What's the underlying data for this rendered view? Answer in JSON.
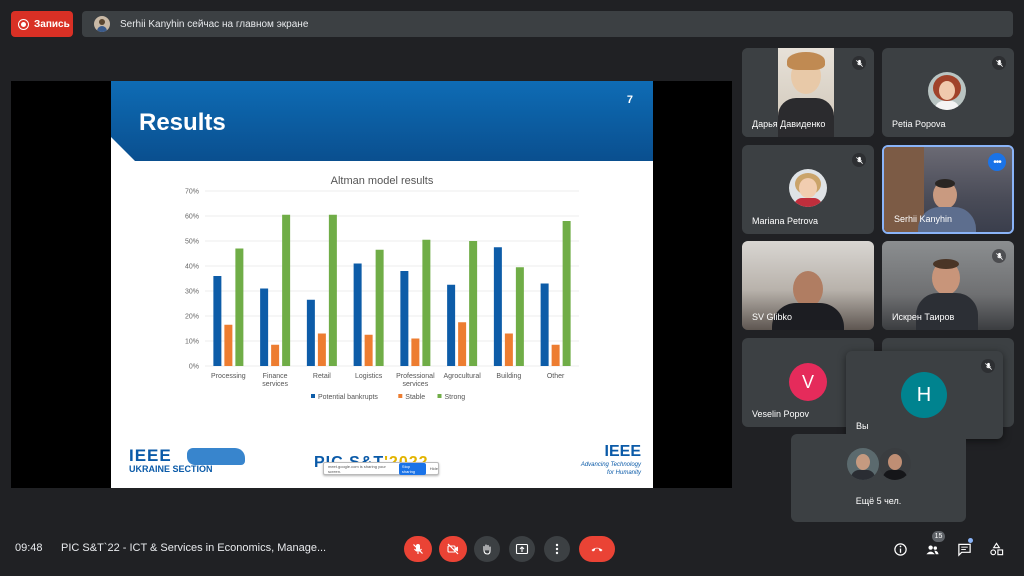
{
  "top": {
    "record_label": "Запись",
    "presenting_text": "Serhii Kanyhin сейчас на главном экране"
  },
  "slide": {
    "title": "Results",
    "number": "7",
    "ieee_ukraine": "IEEE",
    "ieee_ukraine_sub": "UKRAINE SECTION",
    "pic_logo_a": "PIC S&T",
    "pic_logo_b": "'2022",
    "share_strip_text": "meet.google.com is sharing your screen.",
    "share_stop": "Stop sharing",
    "share_hide": "Hide",
    "ieee_right": "IEEE",
    "ieee_right_tag_1": "Advancing Technology",
    "ieee_right_tag_2": "for Humanity"
  },
  "chart_data": {
    "type": "bar",
    "title": "Altman model results",
    "categories": [
      "Processing",
      "Finance services",
      "Retail",
      "Logistics",
      "Professional services",
      "Agrocultural",
      "Building",
      "Other"
    ],
    "series": [
      {
        "name": "Potential bankrupts",
        "color": "#0d5ca8",
        "values": [
          36,
          31,
          26.5,
          41,
          38,
          32.5,
          47.5,
          33
        ]
      },
      {
        "name": "Stable",
        "color": "#ed7d31",
        "values": [
          16.5,
          8.5,
          13,
          12.5,
          11,
          17.5,
          13,
          8.5
        ]
      },
      {
        "name": "Strong",
        "color": "#70ad47",
        "values": [
          47,
          60.5,
          60.5,
          46.5,
          50.5,
          50,
          39.5,
          58
        ]
      }
    ],
    "yticks": [
      "0%",
      "10%",
      "20%",
      "30%",
      "40%",
      "50%",
      "60%",
      "70%"
    ],
    "ylim": [
      0,
      70
    ],
    "grid": true,
    "legend": "bottom"
  },
  "participants": [
    {
      "name": "Дарья Давиденко",
      "muted": true
    },
    {
      "name": "Petia Popova",
      "muted": true
    },
    {
      "name": "Mariana Petrova",
      "muted": true
    },
    {
      "name": "Serhii Kanyhin",
      "muted": false
    },
    {
      "name": "SV Glibko",
      "muted": false
    },
    {
      "name": "Искрен Таиров",
      "muted": true
    },
    {
      "name": "Veselin Popov",
      "initial": "V",
      "color": "#e52b5b"
    }
  ],
  "self_tile": {
    "name": "Вы",
    "initial": "H",
    "color": "#00838f"
  },
  "others": {
    "label": "Ещё 5 чел."
  },
  "bottom": {
    "time": "09:48",
    "meeting": "PIC S&T`22 - ICT & Services in Economics, Manage...",
    "people_count": "15"
  }
}
